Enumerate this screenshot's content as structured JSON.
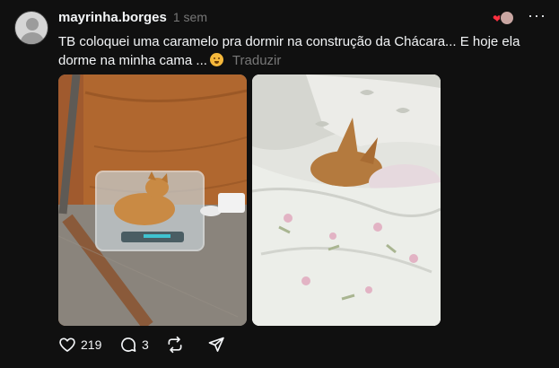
{
  "post": {
    "username": "mayrinha.borges",
    "time": "1 sem",
    "text": "TB coloquei uma caramelo pra dormir na construção da Chácara... E hoje ela dorme na minha cama ...",
    "emoji": "face-with-hand-over-mouth",
    "translate_label": "Traduzir",
    "likes": "219",
    "replies": "3"
  },
  "icons": {
    "avatar": "default-avatar-icon",
    "more": "more-options-icon",
    "like": "heart-icon",
    "reply": "reply-icon",
    "repost": "repost-icon",
    "share": "share-icon"
  },
  "colors": {
    "background": "#101010",
    "text": "#f3f5f7",
    "muted": "#777777",
    "heart": "#ff3040"
  }
}
